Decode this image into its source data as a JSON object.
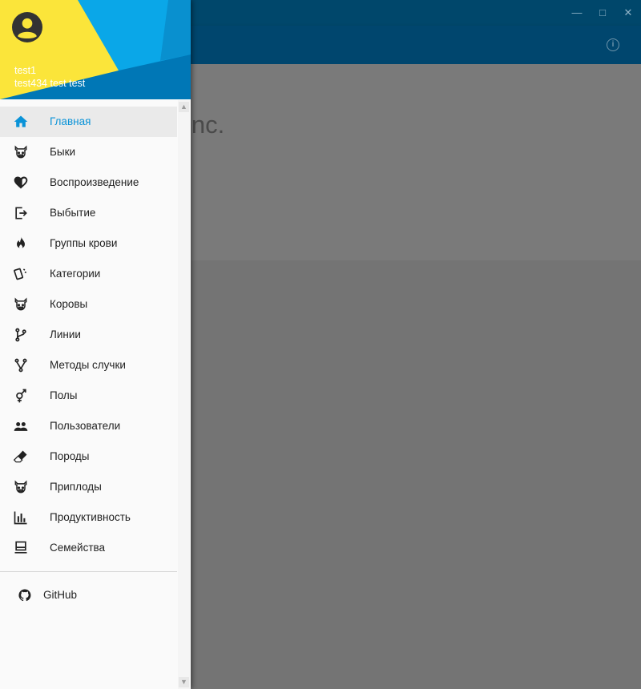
{
  "window": {
    "minimize_icon": "minimize-icon",
    "maximize_icon": "maximize-icon",
    "close_icon": "close-icon"
  },
  "background": {
    "title_fragment": "inc."
  },
  "drawer": {
    "user": {
      "name": "test1",
      "email": "test434 test test"
    },
    "items": [
      {
        "label": "Главная",
        "icon": "home-icon",
        "active": true
      },
      {
        "label": "Быки",
        "icon": "cow-icon"
      },
      {
        "label": "Воспроизведение",
        "icon": "heart-half-icon"
      },
      {
        "label": "Выбытие",
        "icon": "logout-icon"
      },
      {
        "label": "Группы крови",
        "icon": "fire-icon"
      },
      {
        "label": "Категории",
        "icon": "cards-icon"
      },
      {
        "label": "Коровы",
        "icon": "cow-icon"
      },
      {
        "label": "Линии",
        "icon": "source-branch-icon"
      },
      {
        "label": "Методы случки",
        "icon": "source-fork-icon"
      },
      {
        "label": "Полы",
        "icon": "gender-icon"
      },
      {
        "label": "Пользователи",
        "icon": "people-icon"
      },
      {
        "label": "Породы",
        "icon": "eraser-icon"
      },
      {
        "label": "Приплоды",
        "icon": "cow-icon"
      },
      {
        "label": "Продуктивность",
        "icon": "bar-chart-icon"
      },
      {
        "label": "Семейства",
        "icon": "laptop-icon"
      }
    ],
    "github": {
      "label": "GitHub",
      "icon": "github-icon"
    }
  },
  "colors": {
    "accent": "#0a93d8",
    "titlebar": "#00476b",
    "appbar": "#00466e",
    "header_yellow": "#fbe53a",
    "header_blue": "#0aa7e8"
  }
}
